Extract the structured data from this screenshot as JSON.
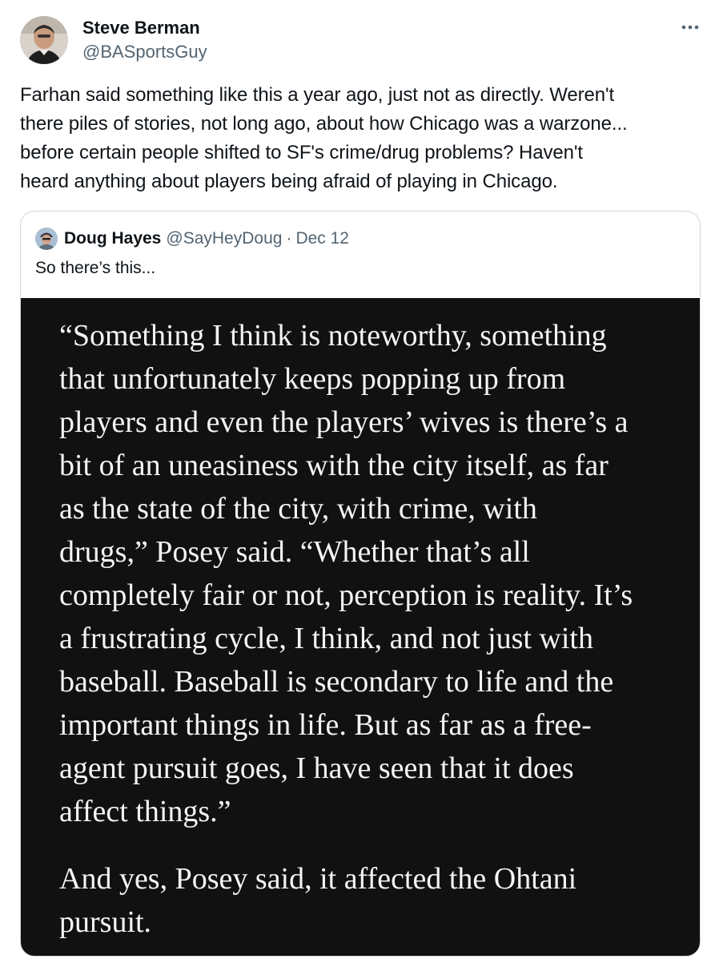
{
  "tweet": {
    "author_name": "Steve Berman",
    "author_handle": "@BASportsGuy",
    "more_icon": "more-horizontal-icon",
    "text": "Farhan said something like this a year ago, just not as directly. Weren't\nthere piles of stories, not long ago, about how Chicago was a warzone...\nbefore certain people shifted to SF's crime/drug problems? Haven't\nheard anything about players being afraid of playing in Chicago."
  },
  "quote": {
    "author_name": "Doug Hayes",
    "author_handle": "@SayHeyDoug",
    "separator": "·",
    "date": "Dec 12",
    "text": "So there’s this...",
    "image": {
      "quote_paragraph": "“Something I think is noteworthy, something\nthat unfortunately keeps popping up from\nplayers and even the players’ wives is there’s a\nbit of an uneasiness with the city itself, as far\nas the state of the city, with crime, with\ndrugs,” Posey said. “Whether that’s all\ncompletely fair or not, perception is reality. It’s\na frustrating cycle, I think, and not just with\nbaseball. Baseball is secondary to life and the\nimportant things in life. But as far as a free-\nagent pursuit goes, I have seen that it does\naffect things.”",
      "followup_paragraph": "And yes, Posey said, it affected the Ohtani\npursuit."
    }
  },
  "colors": {
    "text_primary": "#0f1419",
    "text_secondary": "#536471",
    "card_border": "#cfd9de",
    "media_background": "#111111",
    "media_text": "#f4f4f4"
  }
}
